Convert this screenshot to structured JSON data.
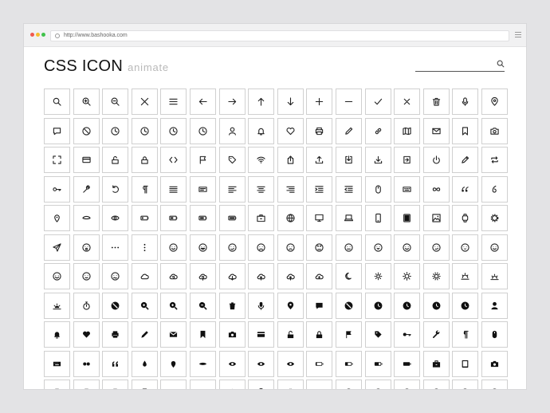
{
  "browser": {
    "url": "http://www.bashooka.com",
    "window_controls": [
      "close",
      "minimize",
      "maximize"
    ]
  },
  "header": {
    "title": "CSS ICON",
    "subtitle": "animate",
    "search_placeholder": ""
  },
  "icons": [
    "search-icon",
    "zoom-in-icon",
    "zoom-out-icon",
    "close-icon",
    "menu-icon",
    "arrow-left-icon",
    "arrow-right-icon",
    "arrow-up-icon",
    "arrow-down-icon",
    "plus-icon",
    "minus-icon",
    "check-icon",
    "x-icon",
    "trash-icon",
    "microphone-icon",
    "location-pin-icon",
    "comment-icon",
    "ban-icon",
    "clock-icon",
    "clock-icon",
    "clock-icon",
    "clock-icon",
    "user-icon",
    "bell-icon",
    "heart-icon",
    "printer-icon",
    "pencil-icon",
    "link-icon",
    "map-icon",
    "mail-icon",
    "bookmark-icon",
    "camera-icon",
    "expand-icon",
    "credit-card-icon",
    "unlock-icon",
    "lock-icon",
    "code-icon",
    "flag-icon",
    "tag-icon",
    "wifi-icon",
    "share-icon",
    "upload-icon",
    "download-box-icon",
    "download-icon",
    "import-icon",
    "power-icon",
    "pen-icon",
    "repeat-icon",
    "key-icon",
    "wrench-icon",
    "refresh-icon",
    "paragraph-icon",
    "align-justify-icon",
    "align-text-icon",
    "align-left-icon",
    "align-center-icon",
    "align-right-icon",
    "indent-icon",
    "outdent-icon",
    "mouse-icon",
    "keyboard-icon",
    "infinity-icon",
    "quote-icon",
    "smart-quote-icon",
    "pin-icon",
    "eye-closed-icon",
    "eye-icon",
    "battery-empty-icon",
    "battery-low-icon",
    "battery-half-icon",
    "battery-full-icon",
    "briefcase-icon",
    "globe-icon",
    "monitor-icon",
    "laptop-icon",
    "phone-icon",
    "tablet-icon",
    "image-icon",
    "watch-icon",
    "gear-icon",
    "send-icon",
    "face-surprised-icon",
    "more-horizontal-icon",
    "more-vertical-icon",
    "face-smile-icon",
    "face-happy-icon",
    "face-wink-icon",
    "face-sad-icon",
    "face-frown-icon",
    "face-angry-icon",
    "face-neutral-icon",
    "face-laugh-icon",
    "face-grin-icon",
    "face-smirk-icon",
    "face-cool-icon",
    "face-love-icon",
    "face-glad-icon",
    "face-calm-icon",
    "face-confused-icon",
    "cloud-icon",
    "cloud-sync-icon",
    "cloud-refresh-icon",
    "cloud-download-icon",
    "cloud-upload-icon",
    "cloud-upload-icon",
    "cloud-add-icon",
    "moon-icon",
    "sun-small-icon",
    "sun-icon",
    "sun-bright-icon",
    "sunrise-icon",
    "sunset-icon",
    "sunset-solid-icon",
    "stopwatch-icon",
    "ban-solid-icon",
    "zoom-in-solid-icon",
    "zoom-in-solid-icon",
    "zoom-out-solid-icon",
    "trash-solid-icon",
    "microphone-solid-icon",
    "location-pin-solid-icon",
    "comment-solid-icon",
    "ban-solid-icon",
    "clock-solid-icon",
    "clock-solid-icon",
    "clock-solid-icon",
    "clock-solid-icon",
    "user-solid-icon",
    "bell-solid-icon",
    "heart-solid-icon",
    "printer-solid-icon",
    "pencil-solid-icon",
    "mail-solid-icon",
    "bookmark-solid-icon",
    "camera-solid-icon",
    "credit-card-solid-icon",
    "unlock-solid-icon",
    "lock-solid-icon",
    "flag-solid-icon",
    "tag-solid-icon",
    "key-solid-icon",
    "wrench-solid-icon",
    "paragraph-solid-icon",
    "mouse-solid-icon",
    "keyboard-solid-icon",
    "infinity-solid-icon",
    "quote-solid-icon",
    "drop-icon",
    "pin-solid-icon",
    "eye-closed-solid-icon",
    "eye-solid-icon",
    "eye-solid-icon",
    "eye-solid-icon",
    "battery-empty-solid-icon",
    "battery-low-solid-icon",
    "battery-half-solid-icon",
    "battery-full-solid-icon",
    "briefcase-solid-icon",
    "tablet-solid-icon",
    "camera-solid-icon",
    "remote-icon",
    "remote-icon",
    "remote-icon",
    "phone-solid-icon",
    "monitor-solid-icon",
    "laptop-solid-icon",
    "mouse-solid-icon",
    "watch-solid-icon",
    "globe-solid-icon",
    "monitor-solid-icon",
    "face-smile-solid-icon",
    "face-happy-solid-icon",
    "face-wink-solid-icon",
    "face-sad-solid-icon",
    "face-frown-solid-icon",
    "face-angry-solid-icon"
  ]
}
